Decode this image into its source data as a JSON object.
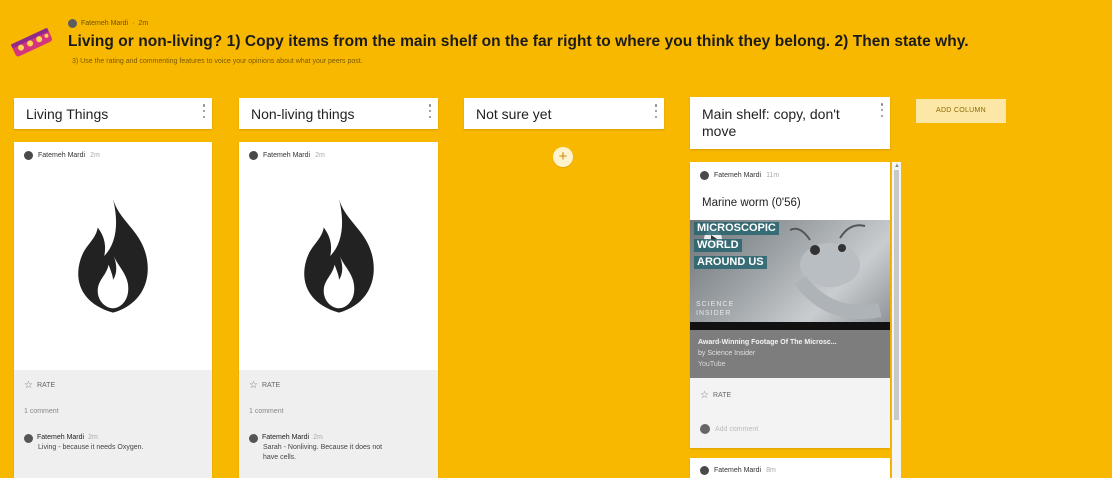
{
  "board": {
    "author": "Fatemeh Mardi",
    "time": "2m",
    "title": "Living or non-living? 1) Copy items from the main shelf on the far right to where you think they belong. 2) Then state why.",
    "subtitle": "3) Use the rating and commenting features to voice your opinions about what your peers post."
  },
  "columns": [
    {
      "title": "Living Things",
      "card": {
        "author": "Fatemeh Mardi",
        "time": "2m",
        "icon": "flame-icon",
        "rate_label": "RATE",
        "comments_count": "1 comment",
        "comment": {
          "author": "Fatemeh Mardi",
          "time": "2m",
          "text": "Living - because it needs Oxygen."
        }
      }
    },
    {
      "title": "Non-living things",
      "card": {
        "author": "Fatemeh Mardi",
        "time": "2m",
        "icon": "flame-icon",
        "rate_label": "RATE",
        "comments_count": "1 comment",
        "comment": {
          "author": "Fatemeh Mardi",
          "time": "2m",
          "text_line1": "Sarah - Nonliving. Because it does not",
          "text_line2": "have cells."
        }
      }
    },
    {
      "title": "Not sure yet",
      "add_label": "+"
    },
    {
      "title_line1": "Main shelf: copy, don't",
      "title_line2": "move",
      "card": {
        "author": "Fatemeh Mardi",
        "time": "11m",
        "title": "Marine worm (0'56)",
        "video_text": [
          "MICROSCOPIC",
          "WORLD",
          "AROUND US"
        ],
        "video_brand": [
          "SCIENCE",
          "INSIDER"
        ],
        "video_title": "Award-Winning Footage Of The Microsc...",
        "video_source": "by Science Insider",
        "video_site": "YouTube",
        "rate_label": "RATE",
        "comment_placeholder": "Add comment"
      },
      "next_card": {
        "author": "Fatemeh Mardi",
        "time": "8m"
      }
    }
  ],
  "add_column_label": "ADD COLUMN"
}
